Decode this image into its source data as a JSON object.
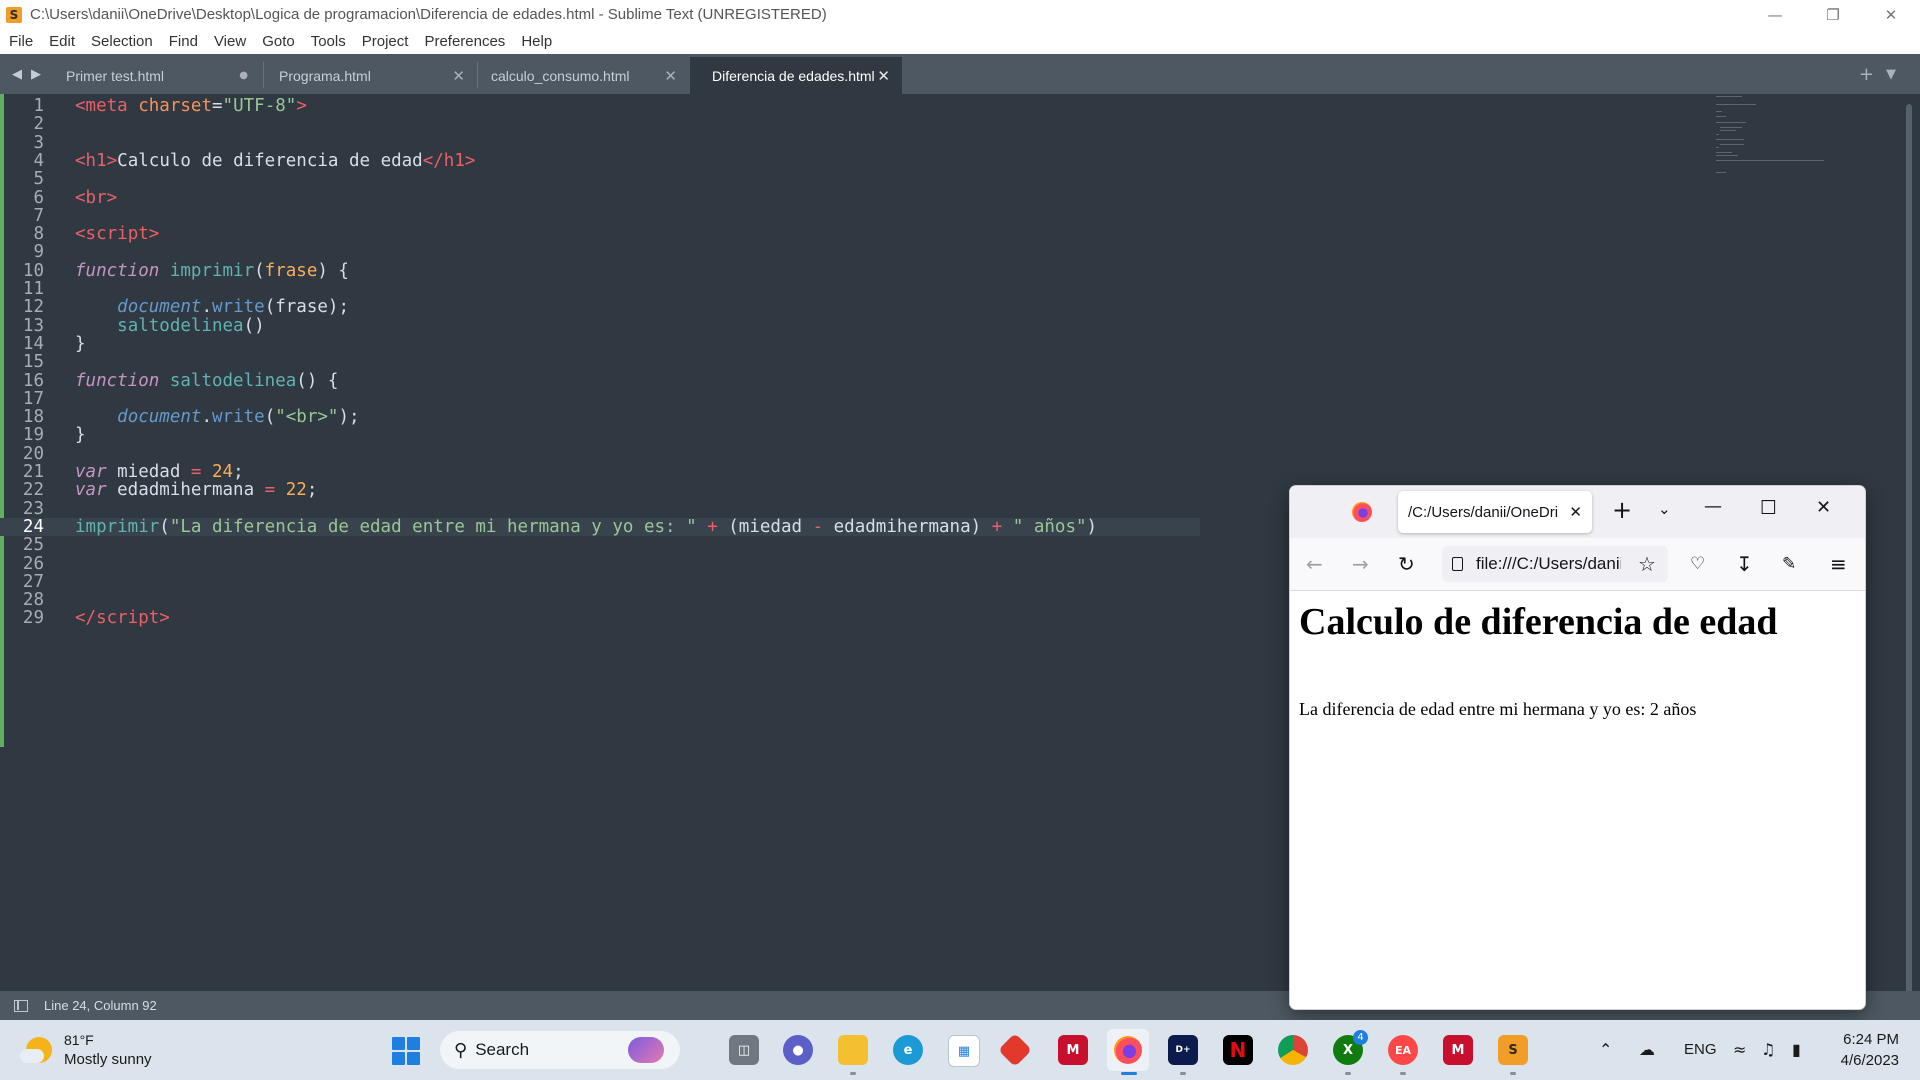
{
  "window": {
    "title": "C:\\Users\\danii\\OneDrive\\Desktop\\Logica de programacion\\Diferencia de edades.html - Sublime Text (UNREGISTERED)"
  },
  "menu": [
    "File",
    "Edit",
    "Selection",
    "Find",
    "View",
    "Goto",
    "Tools",
    "Project",
    "Preferences",
    "Help"
  ],
  "tabs": [
    {
      "label": "Primer test.html",
      "state": "modified"
    },
    {
      "label": "Programa.html",
      "state": "close"
    },
    {
      "label": "calculo_consumo.html",
      "state": "close"
    },
    {
      "label": "Diferencia de edades.html",
      "state": "active"
    }
  ],
  "editor": {
    "current_line": 24,
    "lines": [
      {
        "n": "1"
      },
      {
        "n": "2"
      },
      {
        "n": "3"
      },
      {
        "n": "4"
      },
      {
        "n": "5"
      },
      {
        "n": "6"
      },
      {
        "n": "7"
      },
      {
        "n": "8"
      },
      {
        "n": "9"
      },
      {
        "n": "10"
      },
      {
        "n": "11"
      },
      {
        "n": "12"
      },
      {
        "n": "13"
      },
      {
        "n": "14"
      },
      {
        "n": "15"
      },
      {
        "n": "16"
      },
      {
        "n": "17"
      },
      {
        "n": "18"
      },
      {
        "n": "19"
      },
      {
        "n": "20"
      },
      {
        "n": "21"
      },
      {
        "n": "22"
      },
      {
        "n": "23"
      },
      {
        "n": "24"
      },
      {
        "n": "25"
      },
      {
        "n": "26"
      },
      {
        "n": "27"
      },
      {
        "n": "28"
      },
      {
        "n": "29"
      }
    ],
    "code": {
      "l1_open": "<",
      "l1_tag": "meta",
      "l1_attr": " charset",
      "l1_eq": "=",
      "l1_val": "\"UTF-8\"",
      "l1_close": ">",
      "l4_open": "<",
      "l4_tag": "h1",
      "l4_gt": ">",
      "l4_text": "Calculo de diferencia de edad",
      "l4_end_open": "</",
      "l4_end_tag": "h1",
      "l4_end_gt": ">",
      "l6_open": "<",
      "l6_tag": "br",
      "l6_gt": ">",
      "l8_open": "<",
      "l8_tag": "script",
      "l8_gt": ">",
      "l10_kw": "function",
      "l10_fn": " imprimir",
      "l10_p1": "(",
      "l10_param": "frase",
      "l10_p2": ") {",
      "l12_indent": "    ",
      "l12_obj": "document",
      "l12_dot": ".",
      "l12_met": "write",
      "l12_rest": "(frase);",
      "l13_indent": "    ",
      "l13_fn": "saltodelinea",
      "l13_rest": "()",
      "l14": "}",
      "l16_kw": "function",
      "l16_fn": " saltodelinea",
      "l16_rest": "() {",
      "l18_indent": "    ",
      "l18_obj": "document",
      "l18_dot": ".",
      "l18_met": "write",
      "l18_p1": "(",
      "l18_str": "\"<br>\"",
      "l18_p2": ");",
      "l19": "}",
      "l21_kw": "var",
      "l21_name": " miedad ",
      "l21_op": "=",
      "l21_sp": " ",
      "l21_num": "24",
      "l21_semi": ";",
      "l22_kw": "var",
      "l22_name": " edadmihermana ",
      "l22_op": "=",
      "l22_sp": " ",
      "l22_num": "22",
      "l22_semi": ";",
      "l24_fn": "imprimir",
      "l24_p1": "(",
      "l24_str1": "\"La diferencia de edad entre mi hermana y yo es: \"",
      "l24_sp1": " ",
      "l24_op1": "+",
      "l24_mid1": " (miedad ",
      "l24_op2": "-",
      "l24_mid2": " edadmihermana) ",
      "l24_op3": "+",
      "l24_sp2": " ",
      "l24_str2": "\" años\"",
      "l24_p2": ")",
      "l29_open": "</",
      "l29_tag": "script",
      "l29_gt": ">"
    }
  },
  "statusbar": {
    "position": "Line 24, Column 92"
  },
  "firefox": {
    "tab_title": "/C:/Users/danii/OneDrive/Desktop/Logica de programacion/Diferencia de edades.html",
    "url": "file:///C:/Users/danii/OneDrive/Desktop/Logica de programacion/Diferencia de edades.html",
    "page": {
      "heading": "Calculo de diferencia de edad",
      "result": "La diferencia de edad entre mi hermana y yo es: 2 años"
    }
  },
  "taskbar": {
    "weather_temp": "81°F",
    "weather_desc": "Mostly sunny",
    "search_label": "Search",
    "badge_count": "4",
    "language": "ENG",
    "time": "6:24 PM",
    "date": "4/6/2023"
  }
}
